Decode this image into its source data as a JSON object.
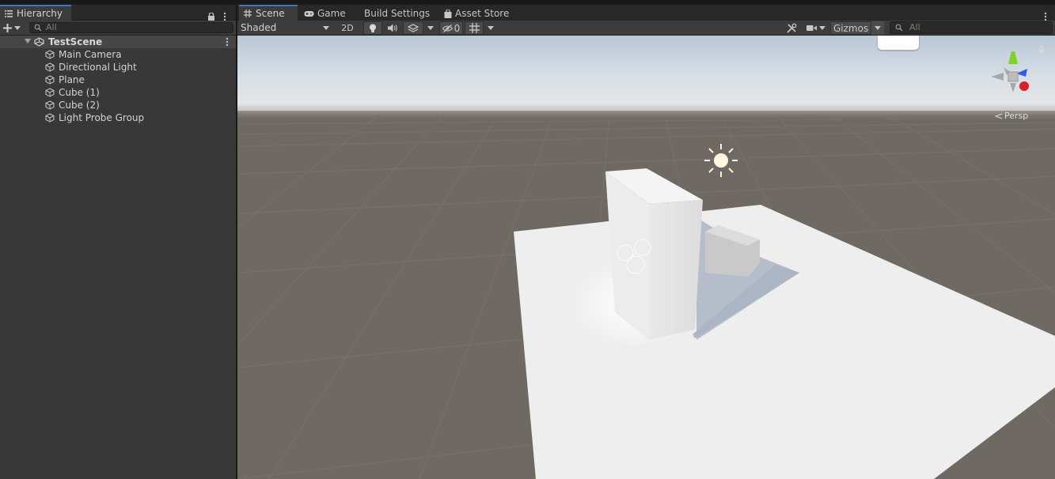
{
  "hierarchy": {
    "tab_label": "Hierarchy",
    "search_placeholder": "All",
    "scene_name": "TestScene",
    "items": [
      {
        "label": "Main Camera"
      },
      {
        "label": "Directional Light"
      },
      {
        "label": "Plane"
      },
      {
        "label": "Cube (1)"
      },
      {
        "label": "Cube (2)"
      },
      {
        "label": "Light Probe Group"
      }
    ]
  },
  "scene_view": {
    "tabs": {
      "scene": "Scene",
      "game": "Game",
      "build_settings": "Build Settings",
      "asset_store": "Asset Store"
    },
    "toolbar": {
      "draw_mode": "Shaded",
      "mode_2d": "2D",
      "hidden_count": "0",
      "gizmos": "Gizmos",
      "search_placeholder": "All"
    },
    "projection_label": "Persp"
  },
  "colors": {
    "accent_tab": "#3a79bb",
    "panel_bg": "#383838",
    "ground": "#6f6964",
    "sky": "#c9d6e2",
    "gizmo_y": "#7ed321",
    "gizmo_z": "#2f5fe0",
    "gizmo_x": "#e02020"
  },
  "icons": {
    "hierarchy_tab": "list-icon",
    "scene_tab": "grid-icon",
    "game_tab": "gamepad-icon",
    "asset_store_tab": "bag-icon",
    "game_object": "cube-icon",
    "scene": "unity-icon",
    "light": "sun-icon"
  }
}
